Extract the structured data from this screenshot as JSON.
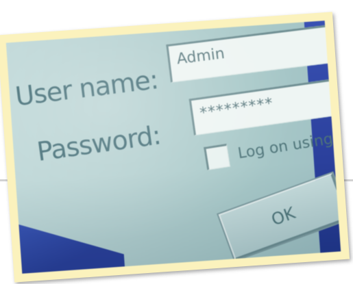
{
  "login_dialog": {
    "user_name_label": "User name:",
    "password_label": "Password:",
    "user_name_value": "Admin",
    "password_value": "*********",
    "log_on_checkbox_label": "Log on using dial",
    "log_on_checkbox_checked": false,
    "ok_button_label": "OK"
  },
  "colors": {
    "screen_background": "#b4d0d0",
    "label_text": "#3f6a73",
    "frame_border": "#fbf2bd",
    "blue_edge": "#2a3e9a"
  }
}
